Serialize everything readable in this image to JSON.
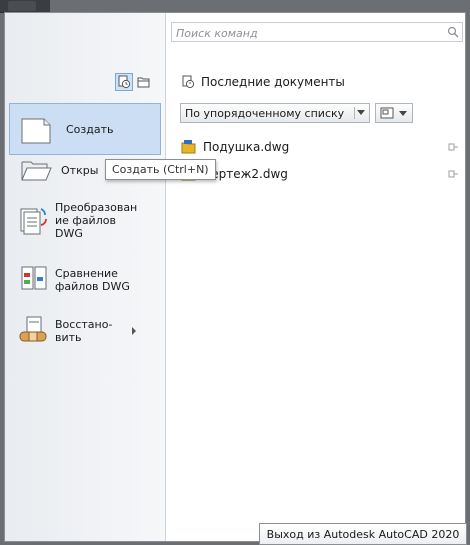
{
  "search": {
    "placeholder": "Поиск команд"
  },
  "left": {
    "items": [
      {
        "id": "create",
        "label": "Создать"
      },
      {
        "id": "open",
        "label": "Откры"
      },
      {
        "id": "convert",
        "label": "Преобразован ие файлов DWG"
      },
      {
        "id": "compare",
        "label": "Сравнение файлов DWG"
      },
      {
        "id": "restore",
        "label": "Восстано-вить"
      }
    ]
  },
  "tooltip": {
    "text": "Создать (Ctrl+N)"
  },
  "recent": {
    "title": "Последние документы",
    "sort": {
      "selected": "По упорядоченному списку"
    },
    "documents": [
      {
        "name": "Подушка.dwg"
      },
      {
        "name": "Чертеж2.dwg"
      }
    ]
  },
  "exit": {
    "label": "Выход из Autodesk AutoCAD 2020"
  },
  "colors": {
    "accent": "#ccdef3",
    "accent_border": "#8fb3da",
    "folder": "#e8b52a"
  },
  "icons": [
    "search-icon",
    "clock-icon",
    "folder-icon",
    "new-doc-icon",
    "open-folder-icon",
    "convert-icon",
    "compare-icon",
    "restore-icon",
    "submenu-arrow-icon",
    "view-mode-icon",
    "dwg-file-icon",
    "pin-icon"
  ]
}
